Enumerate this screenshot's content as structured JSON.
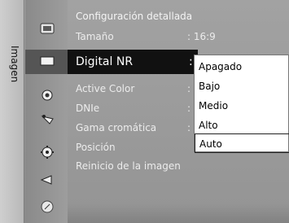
{
  "side_tab": {
    "label": "Imagen"
  },
  "menu": {
    "header": "Configuración detallada",
    "rows": [
      {
        "label": "Tamaño",
        "value": ": 16:9"
      },
      {
        "label": "Digital NR",
        "value": ":"
      },
      {
        "label": "Active Color",
        "value": ":"
      },
      {
        "label": "DNIe",
        "value": ":"
      },
      {
        "label": "Gama cromática",
        "value": ":"
      },
      {
        "label": "Posición",
        "value": ""
      },
      {
        "label": "Reinicio de la imagen",
        "value": ""
      }
    ]
  },
  "dropdown": {
    "items": [
      "Apagado",
      "Bajo",
      "Medio",
      "Alto",
      "Auto"
    ],
    "active": "Auto"
  },
  "icons": [
    "picture-settings-icon",
    "display-icon",
    "sound-icon",
    "satellite-icon",
    "settings-gear-icon",
    "input-icon",
    "support-icon"
  ]
}
